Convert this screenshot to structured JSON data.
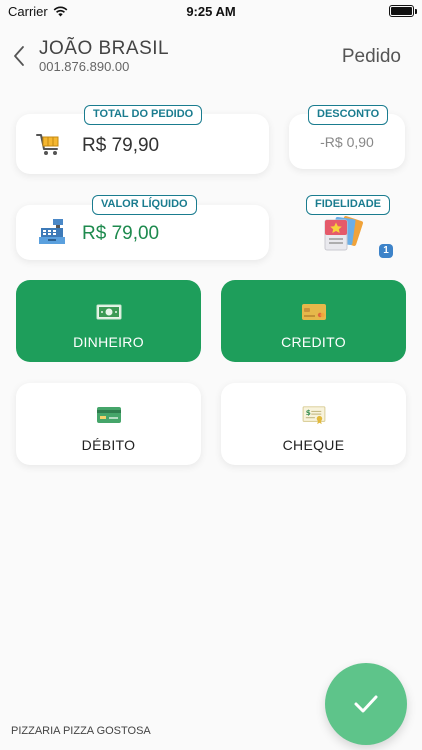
{
  "status_bar": {
    "carrier": "Carrier",
    "time": "9:25 AM"
  },
  "header": {
    "customer_name": "JOÃO BRASIL",
    "customer_doc": "001.876.890.00",
    "title": "Pedido"
  },
  "summary": {
    "total": {
      "tag": "TOTAL DO PEDIDO",
      "value": "R$ 79,90",
      "icon": "shopping-cart-icon"
    },
    "discount": {
      "tag": "DESCONTO",
      "value": "-R$ 0,90"
    },
    "net": {
      "tag": "VALOR LÍQUIDO",
      "value": "R$ 79,00",
      "icon": "cash-register-icon"
    },
    "loyalty": {
      "tag": "FIDELIDADE",
      "badge": "1",
      "icon": "loyalty-cards-icon"
    }
  },
  "payment_methods": [
    {
      "label": "DINHEIRO",
      "icon": "cash-icon"
    },
    {
      "label": "CREDITO",
      "icon": "credit-card-icon"
    },
    {
      "label": "DÉBITO",
      "icon": "debit-card-icon"
    },
    {
      "label": "CHEQUE",
      "icon": "check-icon"
    }
  ],
  "footer": {
    "store_name": "PIZZARIA PIZZA GOSTOSA"
  },
  "colors": {
    "accent_green": "#1e9e5b",
    "tag_teal": "#1a7c8f",
    "net_green": "#1e8a4e",
    "fab_green": "#5ec48a"
  }
}
